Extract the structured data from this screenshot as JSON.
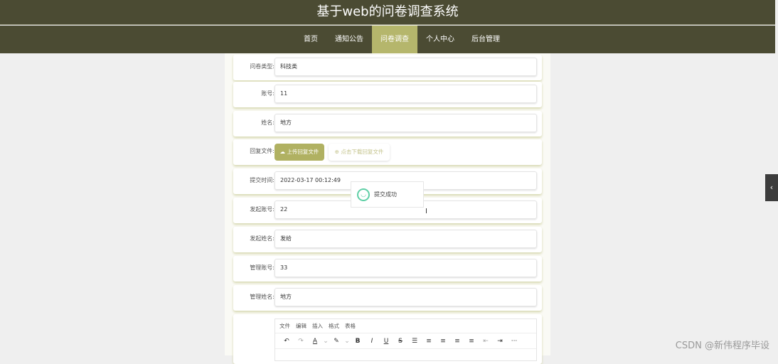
{
  "header": {
    "title": "基于web的问卷调查系统"
  },
  "nav": [
    "首页",
    "通知公告",
    "问卷调查",
    "个人中心",
    "后台管理"
  ],
  "form": {
    "type": {
      "label": "问卷类型:",
      "value": "科技类"
    },
    "account": {
      "label": "账号:",
      "value": "11"
    },
    "name": {
      "label": "姓名:",
      "value": "地方"
    },
    "file": {
      "label": "回复文件:",
      "upload": "上传回复文件",
      "download": "点击下载回复文件"
    },
    "time": {
      "label": "提交时间:",
      "value": "2022-03-17 00:12:49"
    },
    "sender_account": {
      "label": "发起账号:",
      "value": "22"
    },
    "sender_name": {
      "label": "发起姓名:",
      "value": "发给"
    },
    "admin_account": {
      "label": "管理账号:",
      "value": "33"
    },
    "admin_name": {
      "label": "管理姓名:",
      "value": "地方"
    }
  },
  "editor": {
    "menu": [
      "文件",
      "编辑",
      "插入",
      "格式",
      "表格"
    ],
    "tools": [
      "↶",
      "↷",
      "A",
      "⌄",
      "✎",
      "⌄",
      "B",
      "I",
      "U",
      "S",
      "☰",
      "≡",
      "≡",
      "≡",
      "≡",
      "⇤",
      "⇥",
      "···"
    ]
  },
  "toast": {
    "text": "提交成功"
  },
  "side_toggle": "‹",
  "watermark": "CSDN @新伟程序毕设"
}
